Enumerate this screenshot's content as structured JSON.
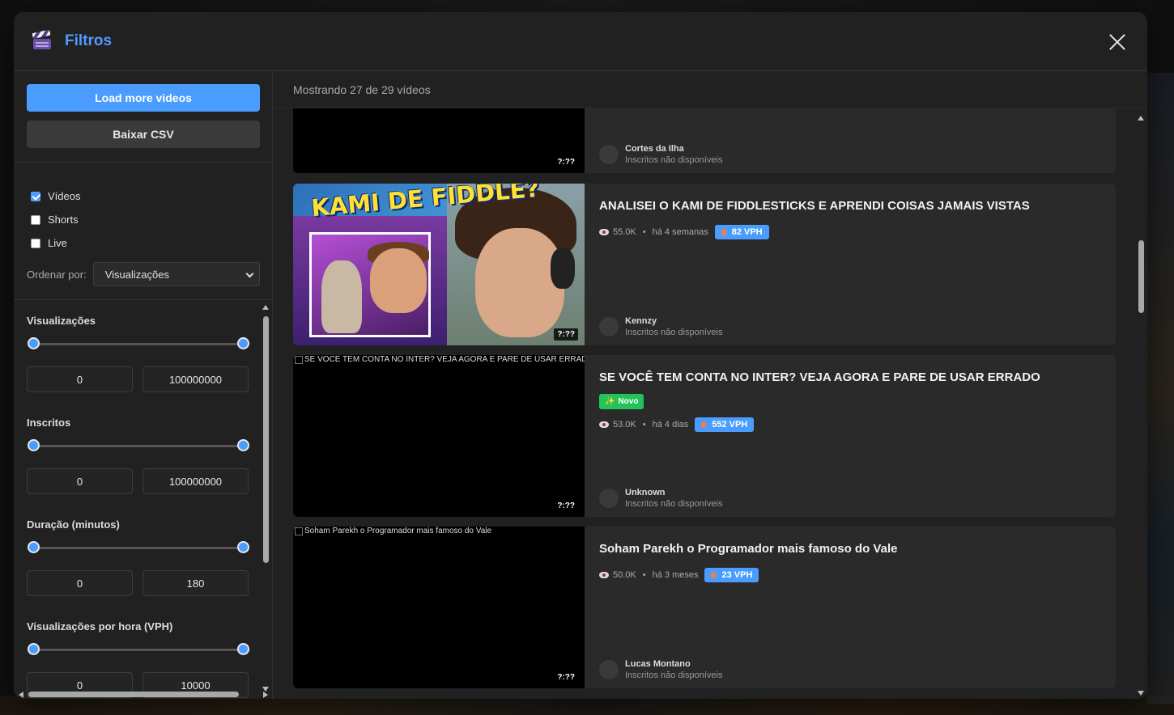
{
  "modal": {
    "title": "Filtros",
    "icon": "clapperboard-icon",
    "close_icon": "close-icon"
  },
  "sidebar": {
    "load_more_label": "Load more videos",
    "csv_label": "Baixar CSV",
    "types": [
      {
        "label": "Vídeos",
        "checked": true
      },
      {
        "label": "Shorts",
        "checked": false
      },
      {
        "label": "Live",
        "checked": false
      }
    ],
    "order_label": "Ordenar por:",
    "order_value": "Visualizações",
    "filters": [
      {
        "title": "Visualizações",
        "min": "0",
        "max": "100000000"
      },
      {
        "title": "Inscritos",
        "min": "0",
        "max": "100000000"
      },
      {
        "title": "Duração (minutos)",
        "min": "0",
        "max": "180"
      },
      {
        "title": "Visualizações por hora (VPH)",
        "min": "0",
        "max": "10000"
      }
    ]
  },
  "main": {
    "count_text": "Mostrando 27 de 29 vídeos",
    "videos": [
      {
        "title": "",
        "channel": "Cortes da Ilha",
        "subs": "Inscritos não disponíveis",
        "duration": "?:??"
      },
      {
        "title": "ANALISEI O KAMI DE FIDDLESTICKS E APRENDI COISAS JAMAIS VISTAS",
        "views": "55.0K",
        "age": "há 4 semanas",
        "vph": "82 VPH",
        "channel": "Kennzy",
        "subs": "Inscritos não disponíveis",
        "duration": "?:??",
        "thumb_text": "KAMI DE FIDDLE?"
      },
      {
        "title": "SE VOCÊ TEM CONTA NO INTER? VEJA AGORA E PARE DE USAR ERRADO",
        "alt": "SE VOCÊ TEM CONTA NO INTER? VEJA AGORA E PARE DE USAR ERRADO",
        "badge": "Novo",
        "views": "53.0K",
        "age": "há 4 dias",
        "vph": "552 VPH",
        "channel": "Unknown",
        "subs": "Inscritos não disponíveis",
        "duration": "?:??"
      },
      {
        "title": "Soham Parekh o Programador mais famoso do Vale",
        "alt": "Soham Parekh o Programador mais famoso do Vale",
        "views": "50.0K",
        "age": "há 3 meses",
        "vph": "23 VPH",
        "channel": "Lucas Montano",
        "subs": "Inscritos não disponíveis",
        "duration": "?:??"
      }
    ],
    "separator": "•"
  },
  "colors": {
    "accent": "#4a9dff",
    "new_badge": "#25c25b",
    "background": "#212121",
    "card": "#2a2a2a"
  }
}
